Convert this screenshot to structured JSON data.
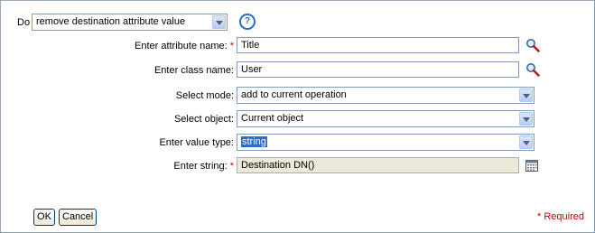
{
  "action": {
    "do_label": "Do",
    "do_value": "remove destination attribute value",
    "help_glyph": "?"
  },
  "fields": {
    "attribute_name": {
      "label": "Enter attribute name:",
      "value": "Title",
      "required_mark": "*"
    },
    "class_name": {
      "label": "Enter class name:",
      "value": "User"
    },
    "mode": {
      "label": "Select mode:",
      "value": "add to current operation"
    },
    "object": {
      "label": "Select object:",
      "value": "Current object"
    },
    "value_type": {
      "label": "Enter value type:",
      "value": "string"
    },
    "string": {
      "label": "Enter string:",
      "value": "Destination DN()",
      "required_mark": "*"
    }
  },
  "buttons": {
    "ok": "OK",
    "cancel": "Cancel"
  },
  "footer": {
    "required_note": "* Required"
  },
  "icons": {
    "help": "help-icon",
    "attr_browse": "magnifier-icon",
    "class_browse": "magnifier-icon",
    "string_editor": "argument-builder-icon"
  },
  "colors": {
    "required": "#cc0000",
    "selection": "#316ac5",
    "border": "#7f9db9"
  }
}
